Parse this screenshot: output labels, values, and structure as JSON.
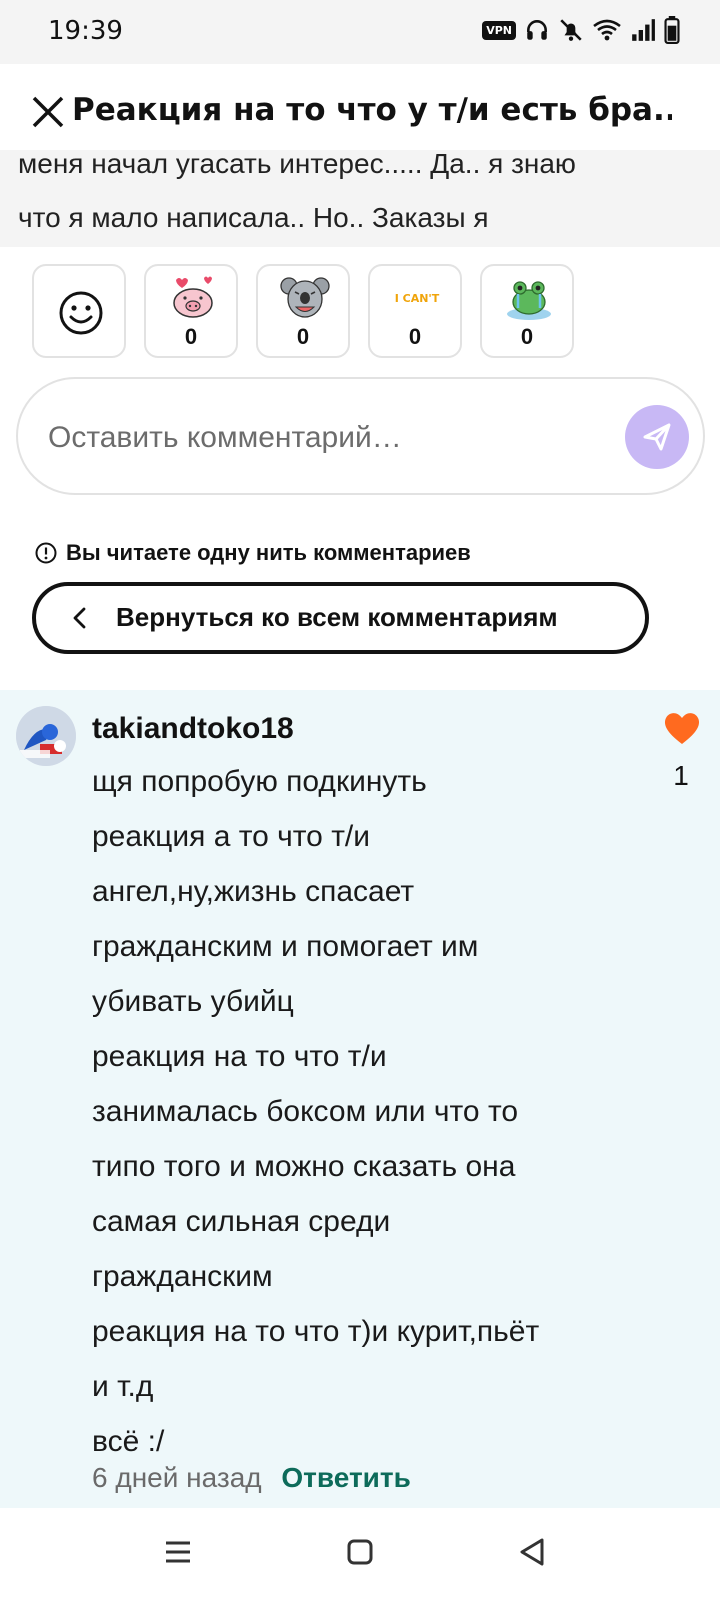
{
  "status_bar": {
    "time": "19:39",
    "vpn_label": "VPN",
    "icons": [
      "vpn-icon",
      "headphones-icon",
      "bell-off-icon",
      "wifi-icon",
      "signal-icon",
      "battery-icon"
    ]
  },
  "header": {
    "close_icon": "close-icon",
    "title": "Реакция на то что у т/и есть бра..."
  },
  "story_excerpt": {
    "lines": [
      "меня начал угасать интерес..... Да.. я знаю",
      "что я мало написала.. Но.. Заказы я"
    ]
  },
  "reactions": {
    "items": [
      {
        "icon": "emoji-picker-icon",
        "count": null
      },
      {
        "icon": "pig-hearts-sticker-icon",
        "count": "0"
      },
      {
        "icon": "koala-laugh-sticker-icon",
        "count": "0"
      },
      {
        "icon": "i-cant-sticker-icon",
        "count": "0"
      },
      {
        "icon": "frog-crying-sticker-icon",
        "count": "0"
      }
    ],
    "sticker_text": "I CAN'T"
  },
  "comment_input": {
    "placeholder": "Оставить комментарий…",
    "send_icon": "send-icon",
    "send_color": "#c8b8f5"
  },
  "thread": {
    "notice": "Вы читаете одну нить комментариев",
    "back_label": "Вернуться ко всем комментариям"
  },
  "comment": {
    "username": "takiandtoko18",
    "lines": [
      "щя попробую подкинуть",
      "реакция а то что т/и",
      "ангел,ну,жизнь спасает",
      "гражданским и помогает им",
      "убивать убийц",
      "реакция на то что т/и",
      "занималась боксом или что то",
      "типо того и можно сказать она",
      "самая сильная среди",
      "гражданским",
      "реакция на то что т)и курит,пьёт",
      "и т.д",
      "всё :/"
    ],
    "likes": "1",
    "heart_color": "#ff6a1f",
    "time": "6 дней назад",
    "reply_label": "Ответить",
    "background": "#eef8fa"
  },
  "nav_bar": {
    "icons": [
      "recent-apps-icon",
      "home-icon",
      "back-icon"
    ]
  }
}
